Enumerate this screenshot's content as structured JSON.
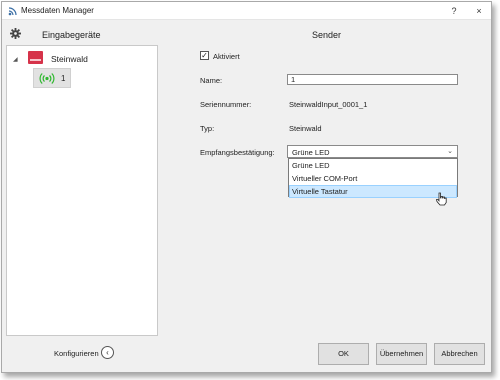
{
  "titlebar": {
    "title": "Messdaten Manager",
    "help": "?",
    "close": "×"
  },
  "left": {
    "title": "Eingabegeräte",
    "tree": {
      "root_label": "Steinwald",
      "child_label": "1"
    },
    "configure_label": "Konfigurieren",
    "configure_glyph": "‹"
  },
  "right": {
    "title": "Sender",
    "activated_label": "Aktiviert",
    "activated_checked": true,
    "activated_mark": "✓",
    "name_label": "Name:",
    "name_value": "1",
    "serial_label": "Seriennummer:",
    "serial_value": "SteinwaldInput_0001_1",
    "type_label": "Typ:",
    "type_value": "Steinwald",
    "ack_label": "Empfangsbestätigung:",
    "ack_selected": "Grüne LED",
    "ack_chevron": "⌄",
    "ack_options": [
      "Grüne LED",
      "Virtueller COM-Port",
      "Virtuelle Tastatur"
    ],
    "ack_hovered_index": 2
  },
  "buttons": {
    "ok": "OK",
    "apply": "Übernehmen",
    "cancel": "Abbrechen"
  },
  "colors": {
    "brand_red": "#d6334a",
    "signal_green": "#2fb82f",
    "hover_blue": "#cce8ff"
  }
}
